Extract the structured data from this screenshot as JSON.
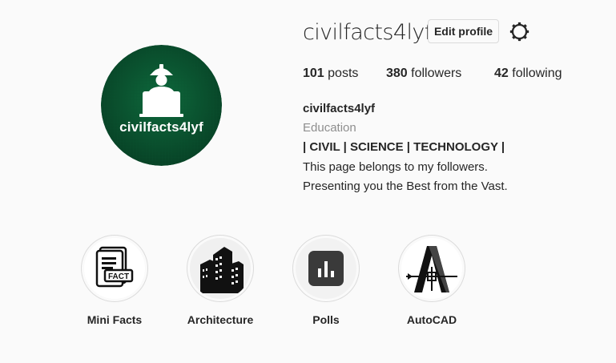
{
  "profile": {
    "username": "civilfacts4lyf",
    "edit_label": "Edit profile",
    "avatar_text": "civilfacts4lyf",
    "stats": {
      "posts_count": "101",
      "posts_label": "posts",
      "followers_count": "380",
      "followers_label": "followers",
      "following_count": "42",
      "following_label": "following"
    },
    "bio": {
      "name": "civilfacts4lyf",
      "category": "Education",
      "tags": "| CIVIL | SCIENCE | TECHNOLOGY |",
      "line1": "This page belongs to my followers.",
      "line2": "Presenting you the Best from the Vast."
    }
  },
  "highlights": [
    {
      "label": "Mini Facts",
      "icon": "fact-document-icon"
    },
    {
      "label": "Architecture",
      "icon": "buildings-icon"
    },
    {
      "label": "Polls",
      "icon": "poll-chart-icon"
    },
    {
      "label": "AutoCAD",
      "icon": "autocad-logo-icon"
    }
  ],
  "icon_labels": {
    "fact_badge": "FACT"
  },
  "colors": {
    "avatar_bg": "#0b5a34",
    "text": "#262626",
    "muted": "#8e8e8e",
    "border": "#dbdbdb"
  }
}
